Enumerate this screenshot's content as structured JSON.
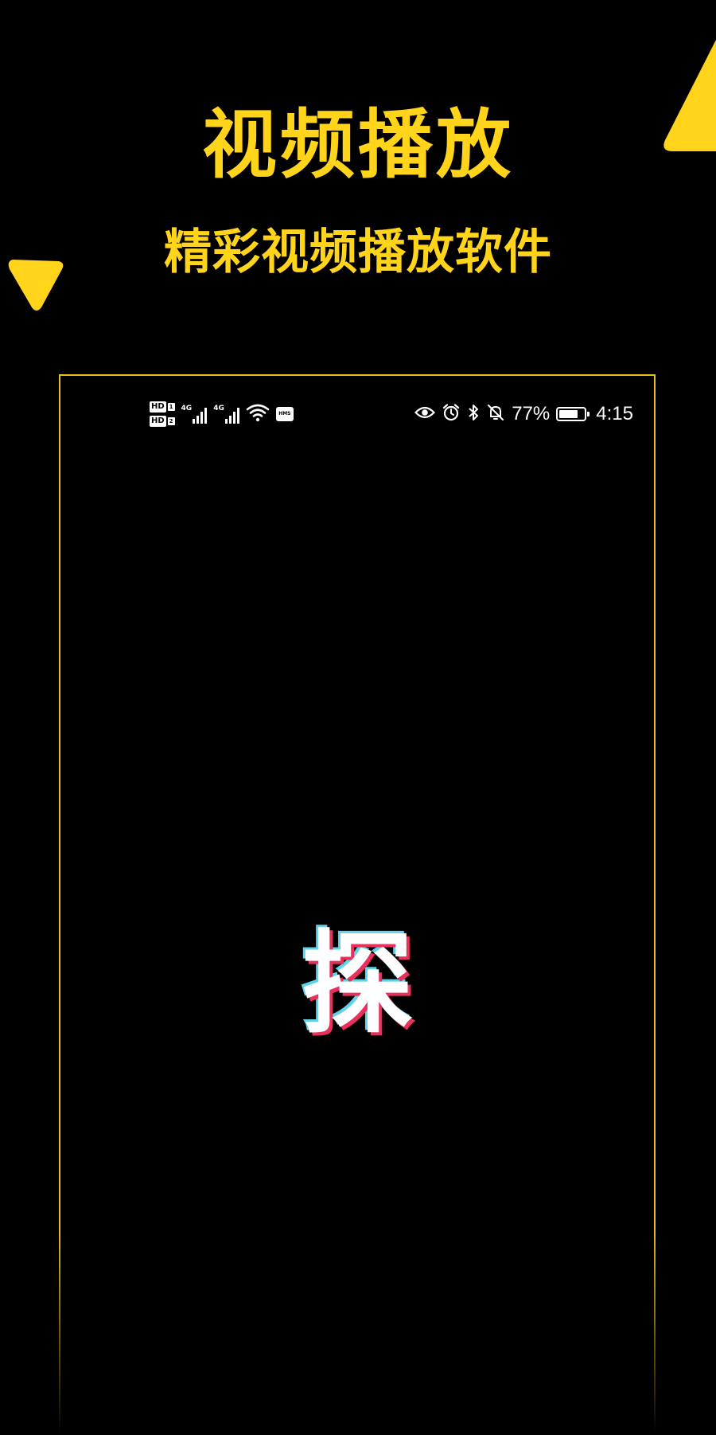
{
  "promo": {
    "title": "视频播放",
    "subtitle": "精彩视频播放软件"
  },
  "colors": {
    "background": "#000000",
    "accent_yellow": "#ffd41a",
    "frame_border": "#e6c01a",
    "logo_cyan": "#5fd3ea",
    "logo_pink": "#e8305c"
  },
  "status_bar": {
    "sim1_label": "HD",
    "sim1_index": "1",
    "sim2_label": "HD",
    "sim2_index": "2",
    "network1": "4G",
    "network2": "4G",
    "hms_label": "HMS",
    "battery_percent_text": "77%",
    "battery_level": 0.77,
    "time": "4:15",
    "icons": [
      "eye-comfort-icon",
      "alarm-icon",
      "bluetooth-icon",
      "mute-bell-icon",
      "battery-icon",
      "wifi-icon",
      "signal-icon"
    ]
  },
  "splash": {
    "logo_char": "探"
  }
}
